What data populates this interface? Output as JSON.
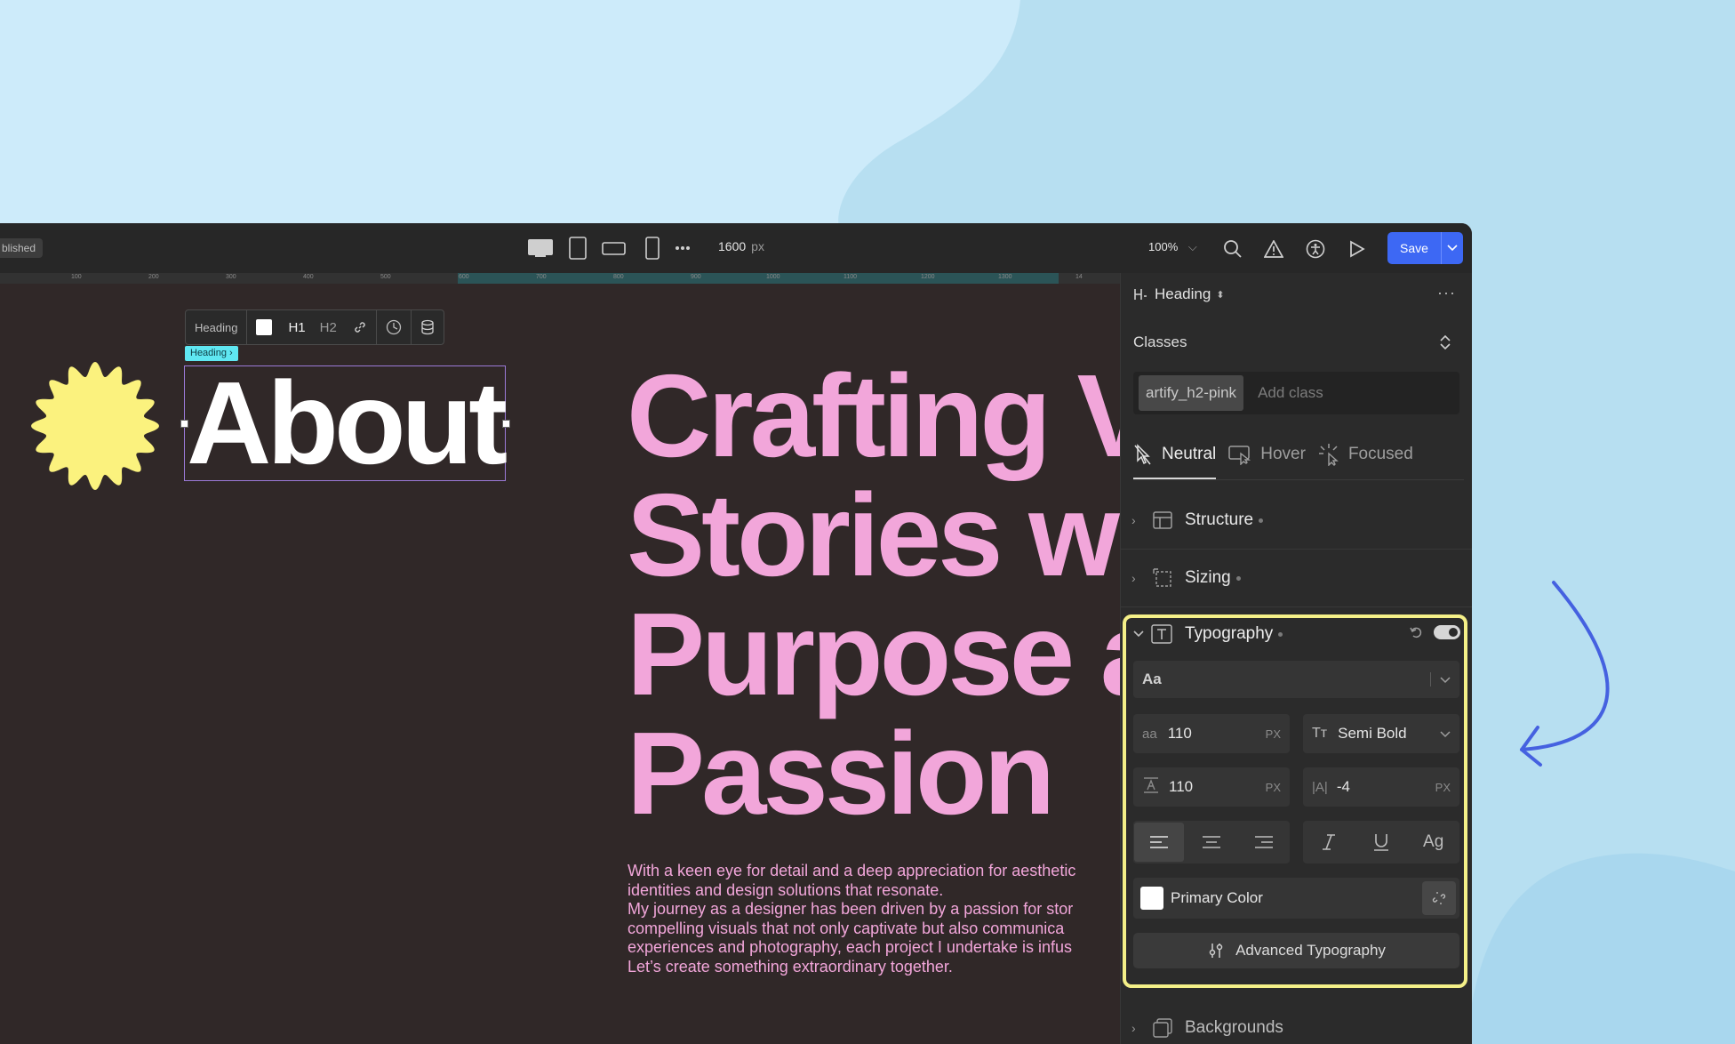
{
  "topbar": {
    "published_label": "blished",
    "canvas_width_value": "1600",
    "canvas_width_unit": "px",
    "zoom_level": "100%",
    "save_label": "Save"
  },
  "ruler": {
    "ticks": [
      "100",
      "200",
      "300",
      "400",
      "500",
      "600",
      "700",
      "800",
      "900",
      "1000",
      "1100",
      "1200",
      "1300",
      "14"
    ]
  },
  "element_toolbar": {
    "type_label": "Heading",
    "h1_label": "H1",
    "h2_label": "H2"
  },
  "canvas": {
    "selected_tag": "Heading",
    "about_heading": "About",
    "hero_heading_lines": [
      "Crafting V",
      "Stories w",
      "Purpose a",
      "Passion"
    ],
    "body_lines": [
      "With a keen eye for detail and a deep appreciation for aesthetic",
      "identities and design solutions that resonate.",
      "My journey as a designer has been driven by a passion for stor",
      "compelling visuals that not only captivate but also communica",
      "experiences and photography, each project I undertake is infus",
      "Let’s create something extraordinary together."
    ],
    "hero_color": "#f2a6da",
    "badge_color": "#fbf27e"
  },
  "panel": {
    "element_title": "Heading",
    "classes_label": "Classes",
    "class_chip": "artify_h2-pink",
    "add_class_placeholder": "Add class",
    "states": [
      "Neutral",
      "Hover",
      "Focused"
    ],
    "sections": {
      "structure": "Structure",
      "sizing": "Sizing",
      "typography": "Typography",
      "backgrounds": "Backgrounds"
    },
    "typography": {
      "font_placeholder": "Aa",
      "font_size": "110",
      "font_size_unit": "PX",
      "font_weight": "Semi Bold",
      "line_height": "110",
      "line_height_unit": "PX",
      "letter_spacing": "-4",
      "letter_spacing_unit": "PX",
      "case_label": "Ag",
      "color_label": "Primary Color",
      "advanced_label": "Advanced Typography"
    }
  },
  "accent": {
    "highlight": "#f4f088",
    "arrow": "#4561e0",
    "save": "#3d68f4"
  }
}
